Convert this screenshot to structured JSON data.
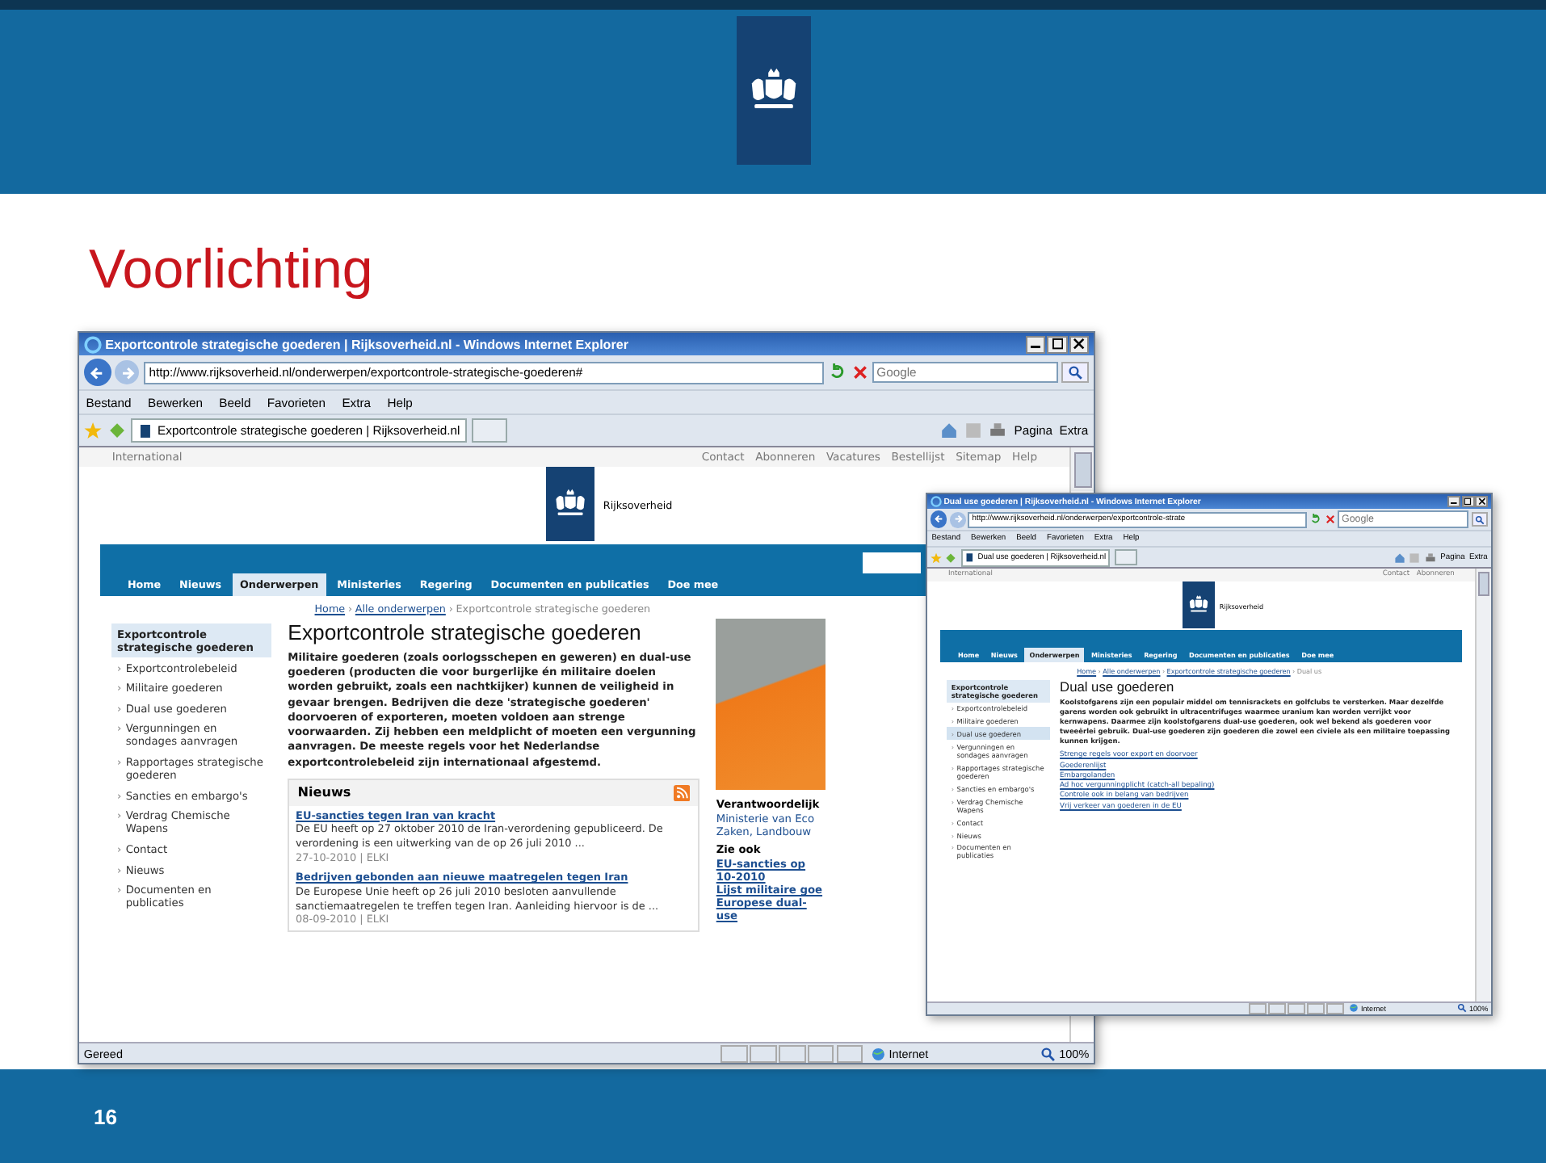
{
  "slide": {
    "title": "Voorlichting",
    "page_number": "16"
  },
  "windows": [
    {
      "title": "Exportcontrole strategische goederen | Rijksoverheid.nl - Windows Internet Explorer",
      "url": "http://www.rijksoverheid.nl/onderwerpen/exportcontrole-strategische-goederen#",
      "search_placeholder": "Google",
      "menu": [
        "Bestand",
        "Bewerken",
        "Beeld",
        "Favorieten",
        "Extra",
        "Help"
      ],
      "tab_label": "Exportcontrole strategische goederen | Rijksoverheid.nl",
      "tools": [
        "Pagina",
        "Extra"
      ],
      "site": {
        "utility_left": "International",
        "utility_links": [
          "Contact",
          "Abonneren",
          "Vacatures",
          "Bestellijst",
          "Sitemap",
          "Help"
        ],
        "logo_text": "Rijksoverheid",
        "nav": [
          {
            "label": "Home",
            "selected": false
          },
          {
            "label": "Nieuws",
            "selected": false
          },
          {
            "label": "Onderwerpen",
            "selected": true
          },
          {
            "label": "Ministeries",
            "selected": false
          },
          {
            "label": "Regering",
            "selected": false
          },
          {
            "label": "Documenten en publicaties",
            "selected": false
          },
          {
            "label": "Doe mee",
            "selected": false
          }
        ],
        "search_field": true,
        "breadcrumb_separator": "›",
        "breadcrumb": [
          {
            "label": "Home",
            "link": true
          },
          {
            "label": "Alle onderwerpen",
            "link": true
          },
          {
            "label": "Exportcontrole strategische goederen",
            "link": false
          }
        ],
        "sidebar_marker": "›",
        "sidebar_heading": "Exportcontrole strategische goederen",
        "sidebar": [
          {
            "label": "Exportcontrolebeleid",
            "selected": false
          },
          {
            "label": "Militaire goederen",
            "selected": false
          },
          {
            "label": "Dual use goederen",
            "selected": false
          },
          {
            "label": "Vergunningen en sondages aanvragen",
            "selected": false
          },
          {
            "label": "Rapportages strategische goederen",
            "selected": false
          },
          {
            "label": "Sancties en embargo's",
            "selected": false
          },
          {
            "label": "Verdrag Chemische Wapens",
            "selected": false
          },
          {
            "label": "Contact",
            "selected": false
          },
          {
            "label": "Nieuws",
            "selected": false
          },
          {
            "label": "Documenten en publicaties",
            "selected": false
          }
        ],
        "heading": "Exportcontrole strategische goederen",
        "intro": "Militaire goederen (zoals oorlogsschepen en geweren) en dual-use goederen (producten die voor burgerlijke én militaire doelen worden gebruikt, zoals een nachtkijker) kunnen de veiligheid in gevaar brengen. Bedrijven die deze 'strategische goederen' doorvoeren of exporteren, moeten voldoen aan strenge voorwaarden. Zij hebben een meldplicht of moeten een vergunning aanvragen. De meeste regels voor het Nederlandse exportcontrolebeleid zijn internationaal afgestemd.",
        "news": {
          "title": "Nieuws",
          "items": [
            {
              "title": "EU-sancties tegen Iran van kracht",
              "summary": "De EU heeft op 27 oktober 2010 de Iran-verordening gepubliceerd. De verordening is een uitwerking van de op 26 juli 2010 ...",
              "meta": "27-10-2010 | ELKI"
            },
            {
              "title": "Bedrijven gebonden aan nieuwe maatregelen tegen Iran",
              "summary": "De Europese Unie heeft op 26 juli 2010 besloten aanvullende sanctiemaatregelen te treffen tegen Iran. Aanleiding hiervoor is de ...",
              "meta": "08-09-2010 | ELKI"
            }
          ]
        },
        "aside": {
          "caption": "Verantwoordelijk",
          "ministry": "Ministerie van Eco Zaken, Landbouw",
          "see_also_title": "Zie ook",
          "see_also": [
            "EU-sancties op 10-2010",
            "Lijst militaire goe",
            "Europese dual-use"
          ]
        }
      },
      "status": {
        "left": "Gereed",
        "zone": "Internet",
        "zoom": "100%"
      }
    },
    {
      "title": "Dual use goederen | Rijksoverheid.nl - Windows Internet Explorer",
      "url": "http://www.rijksoverheid.nl/onderwerpen/exportcontrole-strate",
      "search_placeholder": "Google",
      "menu": [
        "Bestand",
        "Bewerken",
        "Beeld",
        "Favorieten",
        "Extra",
        "Help"
      ],
      "tab_label": "Dual use goederen | Rijksoverheid.nl",
      "tools": [
        "Pagina",
        "Extra"
      ],
      "site": {
        "utility_left": "International",
        "utility_links": [
          "Contact",
          "Abonneren"
        ],
        "logo_text": "Rijksoverheid",
        "nav": [
          {
            "label": "Home",
            "selected": false
          },
          {
            "label": "Nieuws",
            "selected": false
          },
          {
            "label": "Onderwerpen",
            "selected": true
          },
          {
            "label": "Ministeries",
            "selected": false
          },
          {
            "label": "Regering",
            "selected": false
          },
          {
            "label": "Documenten en publicaties",
            "selected": false
          },
          {
            "label": "Doe mee",
            "selected": false
          }
        ],
        "search_field": false,
        "breadcrumb_separator": "›",
        "breadcrumb": [
          {
            "label": "Home",
            "link": true
          },
          {
            "label": "Alle onderwerpen",
            "link": true
          },
          {
            "label": "Exportcontrole strategische goederen",
            "link": true
          },
          {
            "label": "Dual us",
            "link": false
          }
        ],
        "sidebar_marker": "›",
        "sidebar_heading": "Exportcontrole strategische goederen",
        "sidebar": [
          {
            "label": "Exportcontrolebeleid",
            "selected": false
          },
          {
            "label": "Militaire goederen",
            "selected": false
          },
          {
            "label": "Dual use goederen",
            "selected": true
          },
          {
            "label": "Vergunningen en sondages aanvragen",
            "selected": false
          },
          {
            "label": "Rapportages strategische goederen",
            "selected": false
          },
          {
            "label": "Sancties en embargo's",
            "selected": false
          },
          {
            "label": "Verdrag Chemische Wapens",
            "selected": false
          },
          {
            "label": "Contact",
            "selected": false
          },
          {
            "label": "Nieuws",
            "selected": false
          },
          {
            "label": "Documenten en publicaties",
            "selected": false
          }
        ],
        "heading": "Dual use goederen",
        "intro": "Koolstofgarens zijn een populair middel om tennisrackets en golfclubs te versterken. Maar dezelfde garens worden ook gebruikt in ultracentrifuges waarmee uranium kan worden verrijkt voor kernwapens. Daarmee zijn koolstofgarens dual-use goederen, ook wel bekend als goederen voor tweeërlei gebruik. Dual-use goederen zijn goederen die zowel een civiele als een militaire toepassing kunnen krijgen.",
        "links": [
          "Strenge regels voor export en doorvoer",
          "Goederenlijst",
          "Embargolanden",
          "Ad hoc vergunningplicht (catch-all bepaling)",
          "Controle ook in belang van bedrijven",
          "Vrij verkeer van goederen in de EU"
        ]
      },
      "status": {
        "zone": "Internet",
        "zoom": "100%"
      }
    }
  ]
}
